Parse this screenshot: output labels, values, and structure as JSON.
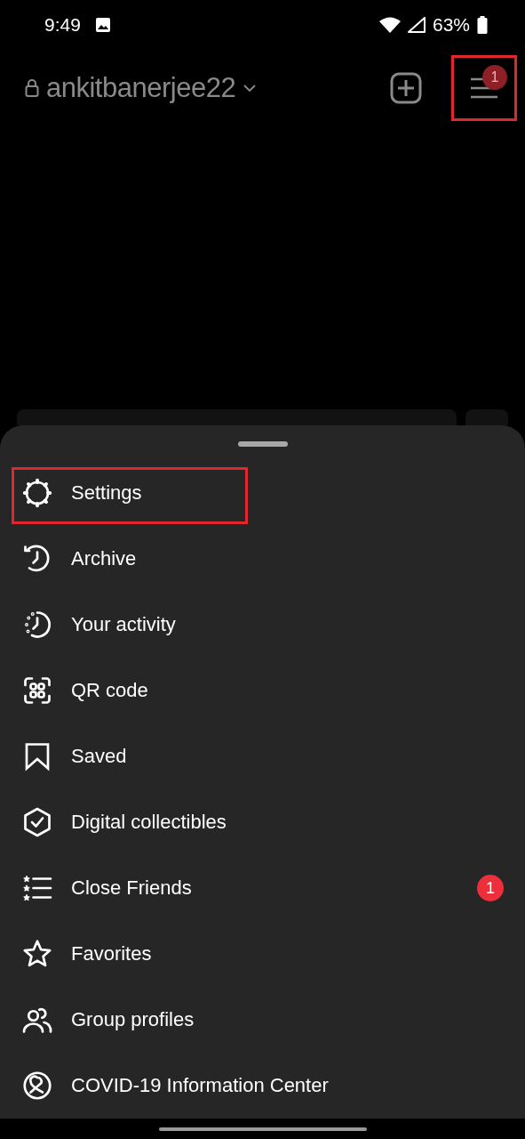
{
  "status_bar": {
    "time": "9:49",
    "battery": "63%"
  },
  "header": {
    "username": "ankitbanerjee22",
    "menu_badge": "1",
    "menu_highlighted": true
  },
  "menu": {
    "items": [
      {
        "label": "Settings",
        "highlighted": true
      },
      {
        "label": "Archive",
        "highlighted": false
      },
      {
        "label": "Your activity",
        "highlighted": false
      },
      {
        "label": "QR code",
        "highlighted": false
      },
      {
        "label": "Saved",
        "highlighted": false
      },
      {
        "label": "Digital collectibles",
        "highlighted": false
      },
      {
        "label": "Close Friends",
        "highlighted": false,
        "badge": "1"
      },
      {
        "label": "Favorites",
        "highlighted": false
      },
      {
        "label": "Group profiles",
        "highlighted": false
      },
      {
        "label": "COVID-19 Information Center",
        "highlighted": false
      }
    ]
  }
}
